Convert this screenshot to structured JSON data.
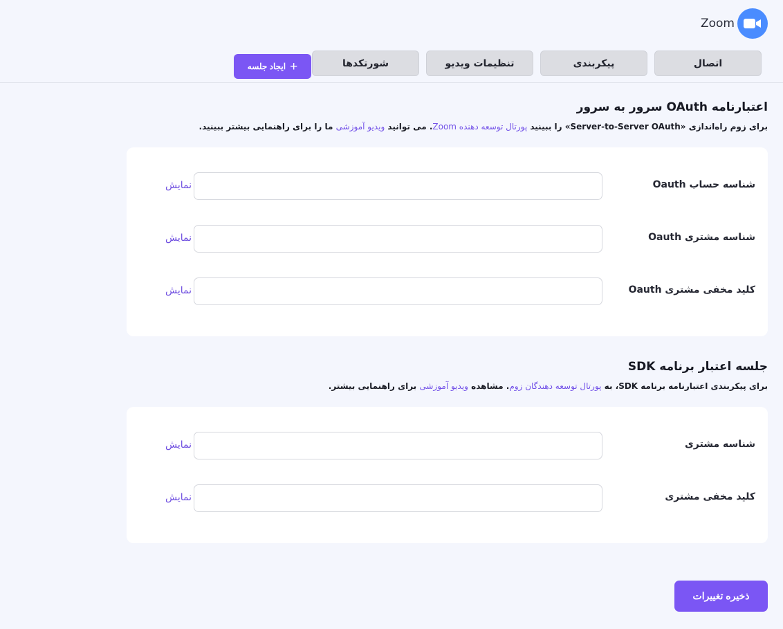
{
  "brand": {
    "name": "Zoom",
    "logo_icon": "video-camera-icon",
    "logo_color": "#4a8cff"
  },
  "tabs": [
    {
      "label": "اتصال"
    },
    {
      "label": "پیکربندی"
    },
    {
      "label": "تنظیمات ویدیو"
    },
    {
      "label": "شورتکدها"
    }
  ],
  "create_button": {
    "label": "ایجاد جلسه",
    "icon": "plus-icon"
  },
  "oauth_section": {
    "title": "اعتبارنامه OAuth سرور به سرور",
    "desc_part1": "برای زوم راه‌اندازی «Server-to-Server OAuth» را ببینید ",
    "desc_link1": "پورتال توسعه دهنده Zoom",
    "desc_part2": ". می توانید ",
    "desc_link2": "ویدیو آموزشی",
    "desc_part3": " ما را برای راهنمایی بیشتر ببینید.",
    "fields": [
      {
        "label": "شناسه حساب Oauth",
        "value": "",
        "show": "نمایش"
      },
      {
        "label": "شناسه مشتری Oauth",
        "value": "",
        "show": "نمایش"
      },
      {
        "label": "کلید مخفی مشتری Oauth",
        "value": "",
        "show": "نمایش"
      }
    ]
  },
  "sdk_section": {
    "title": "جلسه اعتبار برنامه SDK",
    "desc_part1": "برای پیکربندی اعتبارنامه برنامه SDK، به ",
    "desc_link1": "پورتال توسعه دهندگان زوم",
    "desc_part2": ". مشاهده ",
    "desc_link2": "ویدیو آموزشی",
    "desc_part3": " برای راهنمایی بیشتر.",
    "fields": [
      {
        "label": "شناسه مشتری",
        "value": "",
        "show": "نمایش"
      },
      {
        "label": "کلید مخفی مشتری",
        "value": "",
        "show": "نمایش"
      }
    ]
  },
  "save_button": {
    "label": "ذخیره تغییرات"
  },
  "colors": {
    "accent": "#7b56f4",
    "link": "#7352e8",
    "background": "#f4f6fd"
  }
}
